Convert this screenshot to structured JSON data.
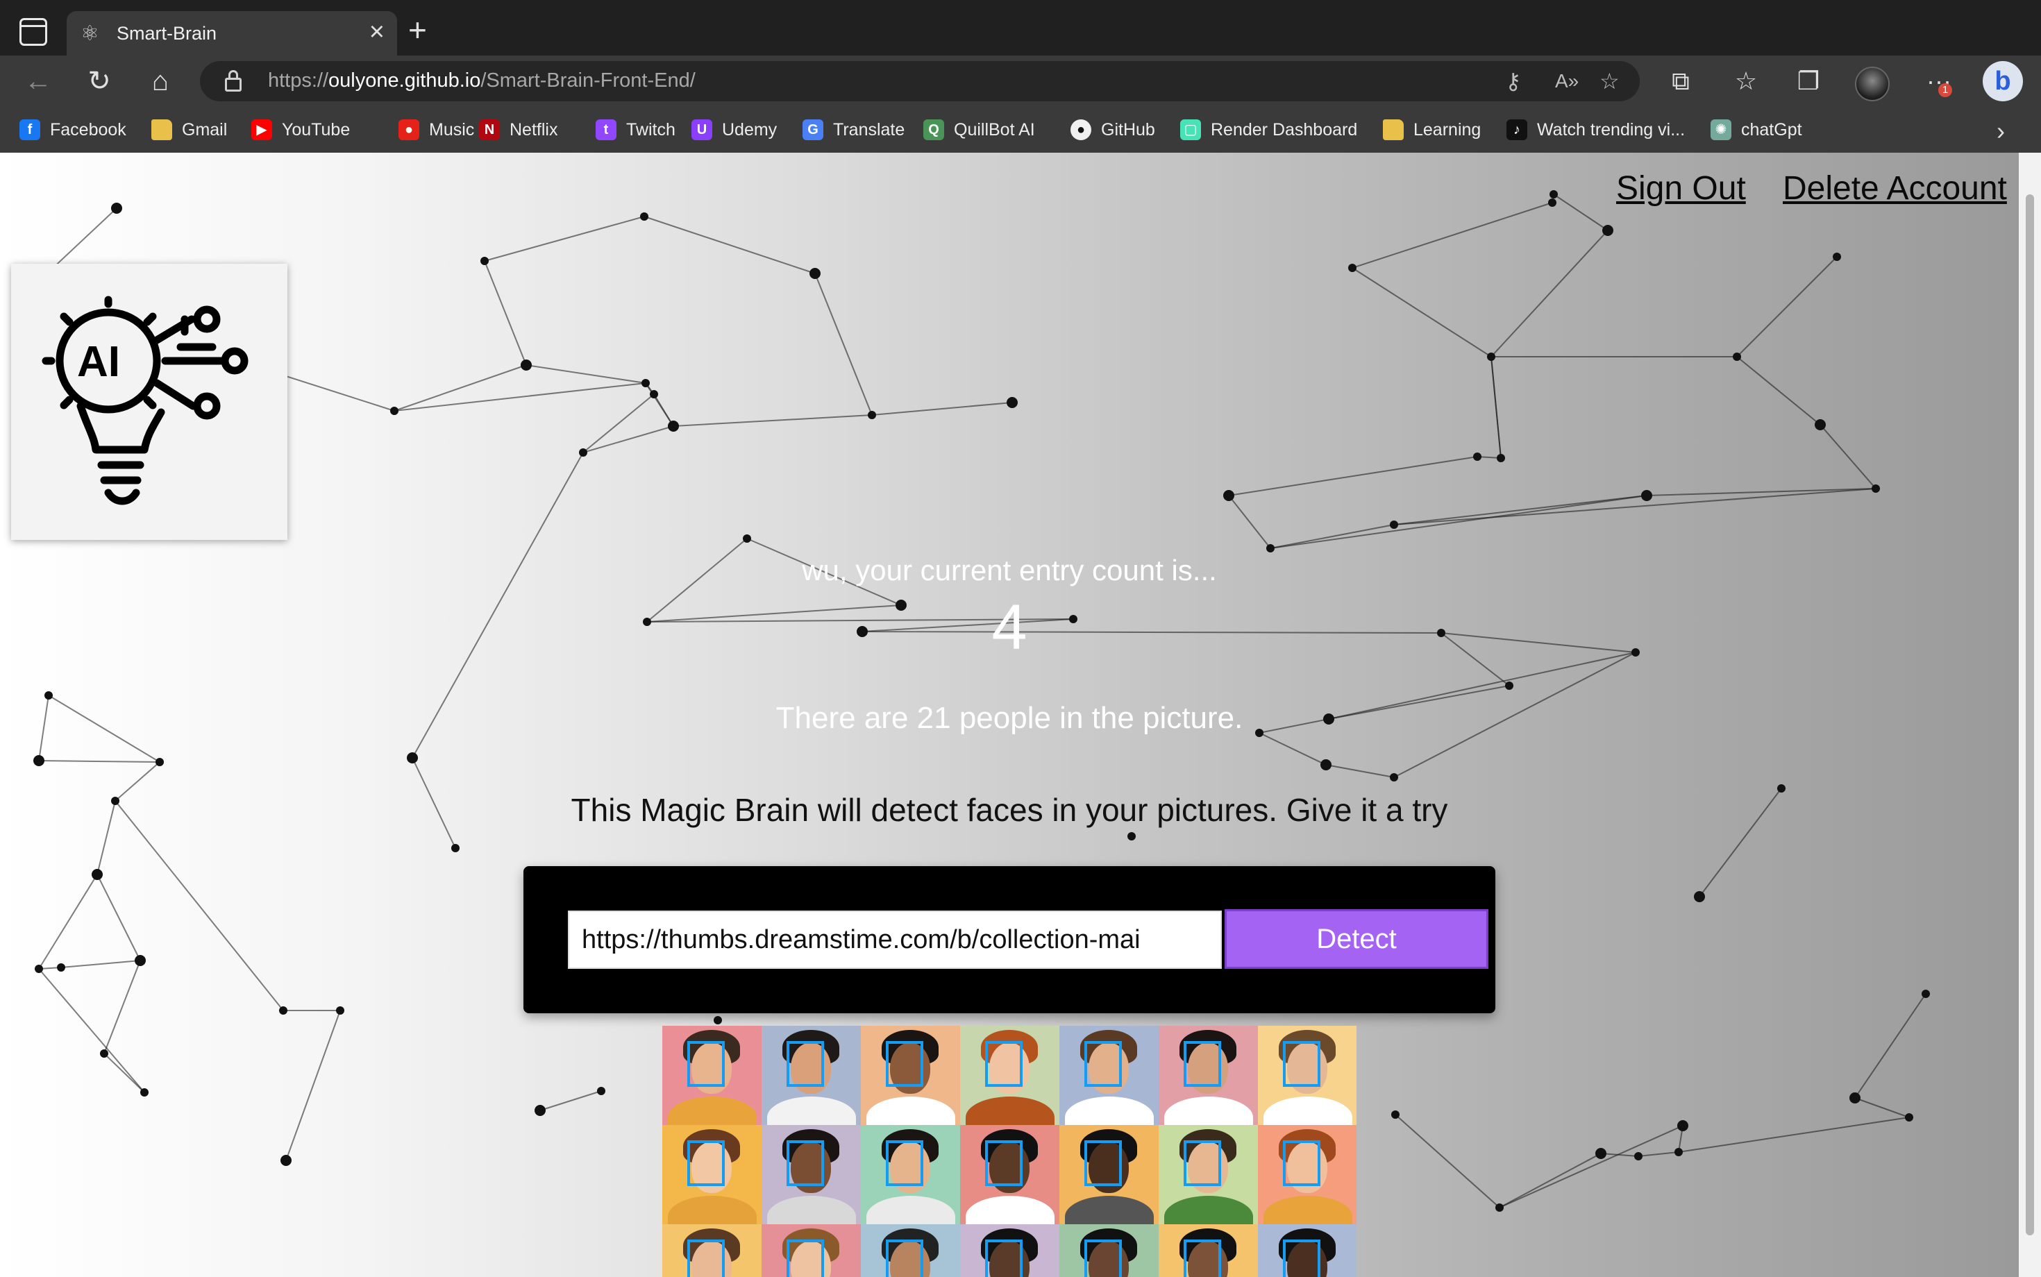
{
  "browser": {
    "tab_title": "Smart-Brain",
    "url_scheme": "https://",
    "url_host": "oulyone.github.io",
    "url_path": "/Smart-Brain-Front-End/",
    "notification_count": "1",
    "bookmarks": [
      {
        "label": "Facebook",
        "icon": "facebook-icon",
        "color": "#1877f2",
        "glyph": "f"
      },
      {
        "label": "Gmail",
        "icon": "folder-icon",
        "color": "#e9c04a",
        "glyph": ""
      },
      {
        "label": "YouTube",
        "icon": "youtube-icon",
        "color": "#ff0000",
        "glyph": "▶"
      },
      {
        "label": "Music",
        "icon": "youtube-music-icon",
        "color": "#e62117",
        "glyph": "●"
      },
      {
        "label": "Netflix",
        "icon": "netflix-icon",
        "color": "#b20710",
        "glyph": "N"
      },
      {
        "label": "Twitch",
        "icon": "twitch-icon",
        "color": "#9146ff",
        "glyph": "t"
      },
      {
        "label": "Udemy",
        "icon": "udemy-icon",
        "color": "#8a3ffc",
        "glyph": "U"
      },
      {
        "label": "Translate",
        "icon": "translate-icon",
        "color": "#4a80f5",
        "glyph": "G"
      },
      {
        "label": "QuillBot AI",
        "icon": "quillbot-icon",
        "color": "#499557",
        "glyph": "Q"
      },
      {
        "label": "GitHub",
        "icon": "github-icon",
        "color": "#f0f0f0",
        "glyph": "●"
      },
      {
        "label": "Render Dashboard",
        "icon": "render-icon",
        "color": "#46e3b7",
        "glyph": "▢"
      },
      {
        "label": "Learning",
        "icon": "folder-icon",
        "color": "#e9c04a",
        "glyph": ""
      },
      {
        "label": "Watch trending vi...",
        "icon": "tiktok-icon",
        "color": "#111111",
        "glyph": "♪"
      },
      {
        "label": "chatGpt",
        "icon": "chatgpt-icon",
        "color": "#74aa9c",
        "glyph": "✺"
      }
    ]
  },
  "nav": {
    "sign_out": "Sign Out",
    "delete_account": "Delete Account"
  },
  "rank": {
    "message": "wu, your current entry count is...",
    "count": "4",
    "people_message": "There are 21 people in the picture."
  },
  "form": {
    "tagline": "This Magic Brain will detect faces in your pictures. Give it a try",
    "input_value": "https://thumbs.dreamstime.com/b/collection-mai",
    "button_label": "Detect"
  },
  "colors": {
    "accent": "#a463f2",
    "face_box": "#149df2"
  }
}
